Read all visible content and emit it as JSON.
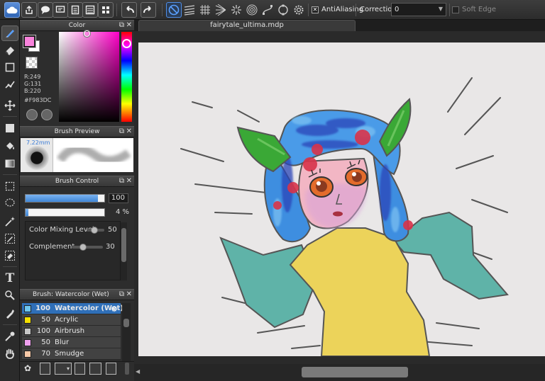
{
  "toolbar": {
    "antialiasing_label": "AntiAliasing",
    "correction_label": "Correction",
    "correction_value": "0",
    "soft_edge_label": "Soft Edge",
    "antialiasing_checked": "✕"
  },
  "tools": [
    "brush",
    "eraser",
    "select-rectangle",
    "pen",
    "move",
    "fill-rectangle",
    "bucket",
    "gradient",
    "select",
    "lasso",
    "magic-wand",
    "select-pen",
    "select-eraser",
    "text",
    "operation",
    "dropper",
    "eyedropper",
    "hand"
  ],
  "color_panel": {
    "title": "Color",
    "r": "R:249",
    "g": "G:131",
    "b": "B:220",
    "hex": "#F983DC",
    "fg_color": "#f983dc",
    "bg_color": "#ffffff"
  },
  "brush_preview": {
    "title": "Brush Preview",
    "size_label": "7.22mm"
  },
  "brush_control": {
    "title": "Brush Control",
    "size_value": "100",
    "size_fraction": 0.92,
    "opacity_value": "4 %",
    "opacity_fraction": 0.04,
    "color_mixing_label": "Color Mixing Level",
    "color_mixing_value": "50",
    "complement_label": "Complement",
    "complement_value": "30"
  },
  "brush_list": {
    "title": "Brush: Watercolor (Wet)",
    "items": [
      {
        "size": "100",
        "name": "Watercolor (Wet)",
        "color": "#6ec6f0",
        "selected": true
      },
      {
        "size": "50",
        "name": "Acrylic",
        "color": "#f5e000"
      },
      {
        "size": "100",
        "name": "Airbrush",
        "color": "#c8c8c8"
      },
      {
        "size": "50",
        "name": "Blur",
        "color": "#f0a0f0"
      },
      {
        "size": "70",
        "name": "Smudge",
        "color": "#f7c9a8"
      }
    ]
  },
  "document": {
    "tab_title": "fairytale_ultima.mdp"
  }
}
